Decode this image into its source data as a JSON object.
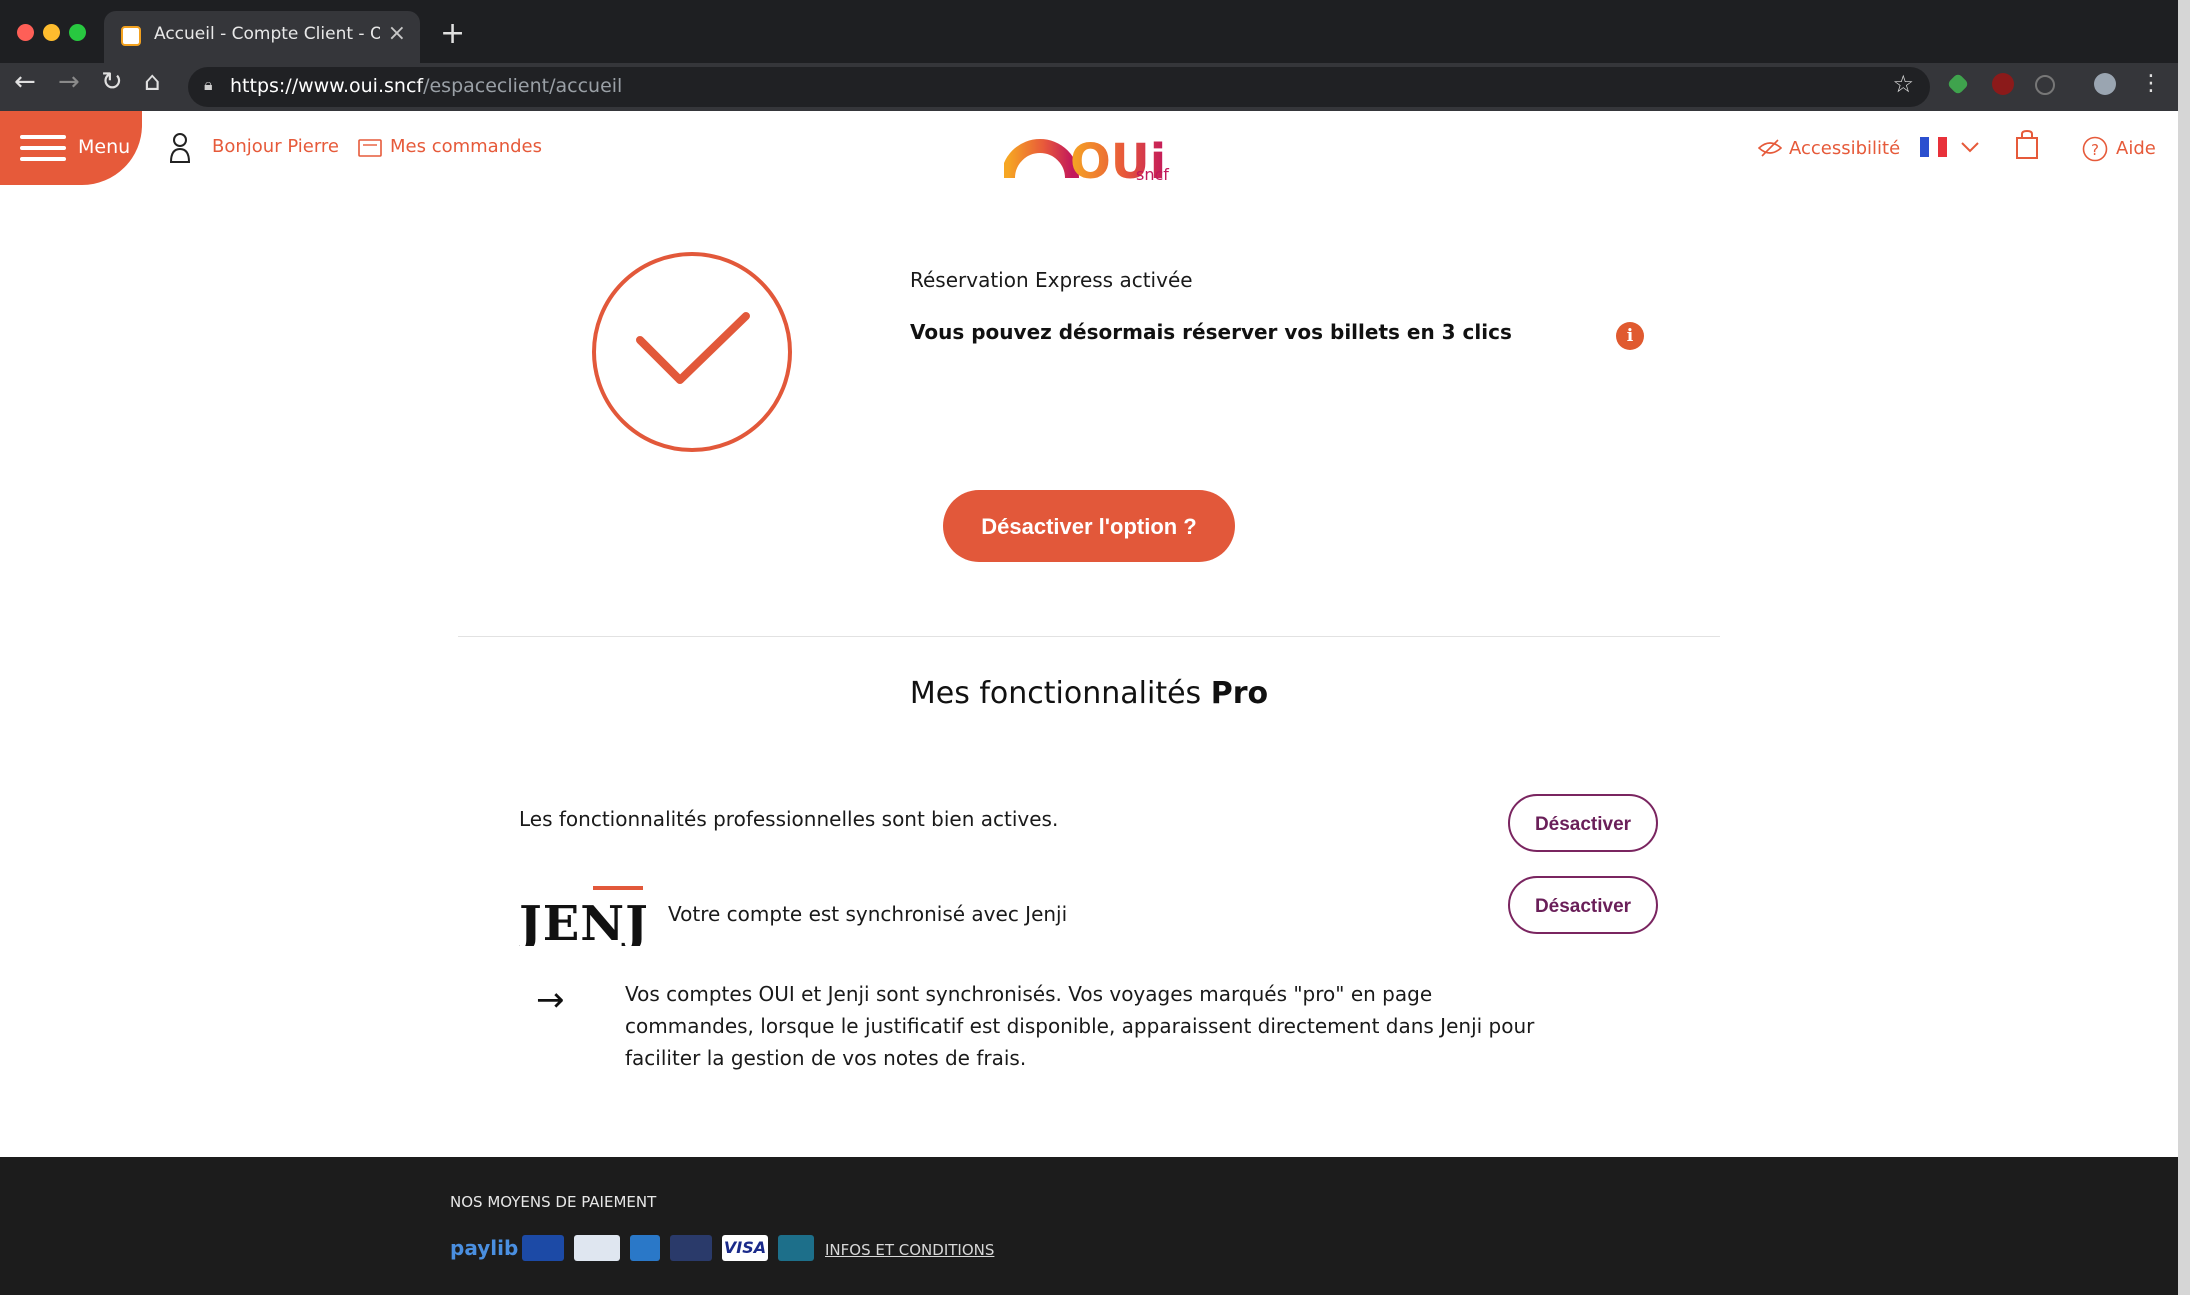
{
  "browser": {
    "tab_title": "Accueil - Compte Client - OUI.s",
    "url_host": "https://www.oui.sncf",
    "url_path": "/espaceclient/accueil"
  },
  "header": {
    "menu_label": "Menu",
    "greeting": "Bonjour Pierre",
    "orders": "Mes commandes",
    "logo_main": "OUi",
    "logo_sub": "sncf",
    "accessibility": "Accessibilité",
    "help": "Aide"
  },
  "express": {
    "title": "Réservation Express activée",
    "subtitle": "Vous pouvez désormais réserver vos billets en 3 clics",
    "info_glyph": "i",
    "deactivate_button": "Désactiver l'option ?"
  },
  "pro": {
    "heading_prefix": "Mes fonctionnalités",
    "heading_bold": "Pro",
    "active_text": "Les fonctionnalités professionnelles sont bien actives.",
    "deactivate_1": "Désactiver",
    "jenji_logo": "JENJI",
    "jenji_text": "Votre compte est synchronisé avec Jenji",
    "deactivate_2": "Désactiver",
    "description": "Vos comptes OUI et Jenji sont synchronisés. Vos voyages marqués \"pro\" en page commandes, lorsque le justificatif est disponible, apparaissent directement dans Jenji pour faciliter la gestion de vos notes de frais."
  },
  "footer": {
    "payment_title": "NOS MOYENS DE PAIEMENT",
    "payments": [
      "paylib",
      "Maestro",
      "e-carte bleue",
      "American Express",
      "MasterCard",
      "VISA",
      "CB"
    ],
    "conditions_link": "INFOS ET CONDITIONS"
  },
  "colors": {
    "brand": "#e65a3a",
    "pro_purple": "#7a2560",
    "footer_bg": "#1c1c1c"
  }
}
